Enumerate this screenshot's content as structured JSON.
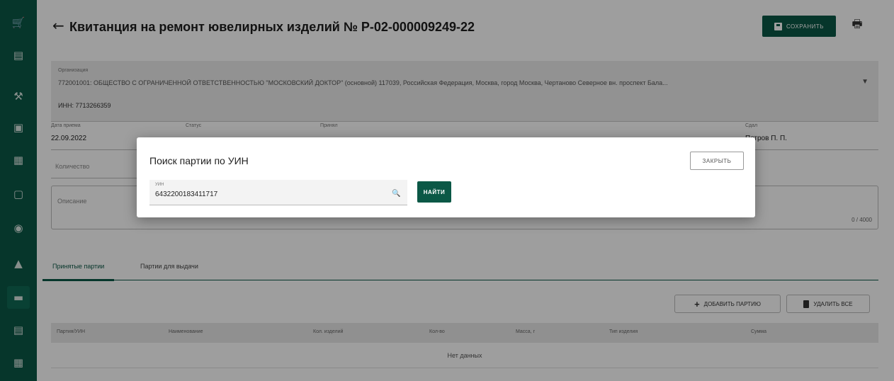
{
  "colors": {
    "accent": "#0b5846",
    "overlay": "rgba(0,0,0,0.38)"
  },
  "rail": {
    "items": [
      {
        "icon": "cart-icon",
        "glyph": "🛒"
      },
      {
        "icon": "list-icon",
        "glyph": "▤"
      },
      {
        "icon": "tools-icon",
        "glyph": "⚒"
      },
      {
        "icon": "document-icon",
        "glyph": "▣"
      },
      {
        "icon": "table-icon",
        "glyph": "▦"
      },
      {
        "icon": "inbox-icon",
        "glyph": "▢"
      },
      {
        "icon": "coin-icon",
        "glyph": "◉"
      },
      {
        "icon": "building-icon",
        "glyph": "▲"
      },
      {
        "icon": "card-icon",
        "glyph": "▬"
      },
      {
        "icon": "panel-icon",
        "glyph": "▤"
      },
      {
        "icon": "grid-icon",
        "glyph": "▦"
      }
    ]
  },
  "header": {
    "back_icon": "arrow-left-icon",
    "title": "Квитанция на ремонт ювелирных изделий № Р-02-000009249-22",
    "save_label": "СОХРАНИТЬ",
    "print_icon": "printer-icon"
  },
  "org": {
    "label": "Организация",
    "value": "772001001: ОБЩЕСТВО С ОГРАНИЧЕННОЙ ОТВЕТСТВЕННОСТЬЮ \"МОСКОВСКИЙ ДОКТОР\" (основной) 117039, Российская Федерация, Москва, город Москва, Чертаново Северное вн. проспект Бала...",
    "inn": "ИНН: 7713266359"
  },
  "fields": {
    "date_label": "Дата приема",
    "date_value": "22.09.2022",
    "status_label": "Статус",
    "received_label": "Принял",
    "issued_label": "Сдал",
    "issued_value": "Петров П. П."
  },
  "qty": {
    "label": "Количество"
  },
  "description": {
    "label": "Описание",
    "counter": "0 / 4000"
  },
  "tabs": [
    {
      "label": "Принятые партии"
    },
    {
      "label": "Партии для выдачи"
    }
  ],
  "actions": {
    "add_label": "ДОБАВИТЬ ПАРТИЮ",
    "delete_label": "УДАЛИТЬ ВСЕ"
  },
  "table": {
    "columns": [
      "Партия/УИН",
      "Наименование",
      "Кол. изделий",
      "Кол-во",
      "Масса, г",
      "Тип изделия",
      "Сумма"
    ],
    "empty_text": "Нет данных"
  },
  "dialog": {
    "title": "Поиск партии по УИН",
    "close_label": "ЗАКРЫТЬ",
    "uin_label": "УИН",
    "uin_value": "6432200183411717",
    "find_label": "НАЙТИ"
  }
}
